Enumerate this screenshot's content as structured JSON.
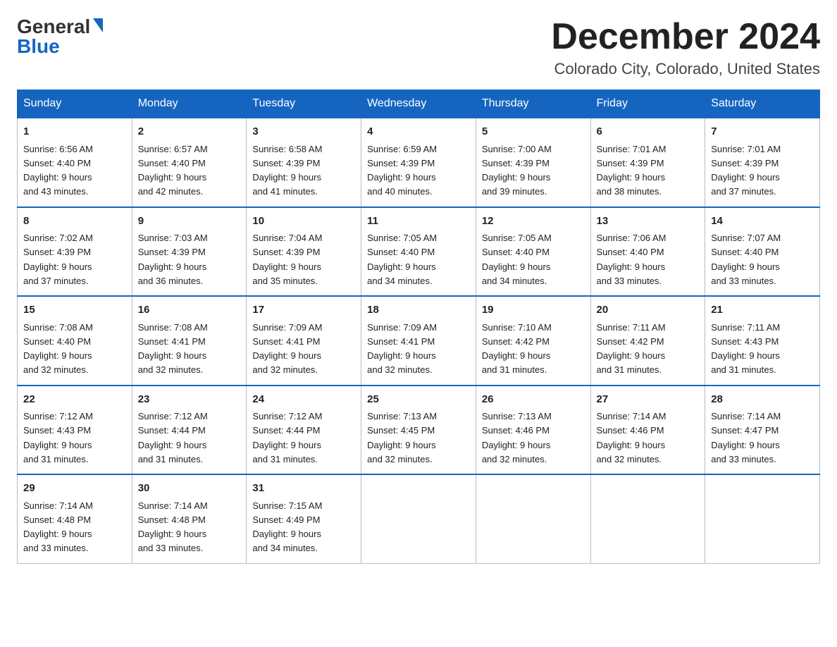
{
  "header": {
    "logo_general": "General",
    "logo_blue": "Blue",
    "month": "December 2024",
    "location": "Colorado City, Colorado, United States"
  },
  "days_of_week": [
    "Sunday",
    "Monday",
    "Tuesday",
    "Wednesday",
    "Thursday",
    "Friday",
    "Saturday"
  ],
  "weeks": [
    [
      {
        "day": "1",
        "sunrise": "6:56 AM",
        "sunset": "4:40 PM",
        "daylight": "9 hours and 43 minutes."
      },
      {
        "day": "2",
        "sunrise": "6:57 AM",
        "sunset": "4:40 PM",
        "daylight": "9 hours and 42 minutes."
      },
      {
        "day": "3",
        "sunrise": "6:58 AM",
        "sunset": "4:39 PM",
        "daylight": "9 hours and 41 minutes."
      },
      {
        "day": "4",
        "sunrise": "6:59 AM",
        "sunset": "4:39 PM",
        "daylight": "9 hours and 40 minutes."
      },
      {
        "day": "5",
        "sunrise": "7:00 AM",
        "sunset": "4:39 PM",
        "daylight": "9 hours and 39 minutes."
      },
      {
        "day": "6",
        "sunrise": "7:01 AM",
        "sunset": "4:39 PM",
        "daylight": "9 hours and 38 minutes."
      },
      {
        "day": "7",
        "sunrise": "7:01 AM",
        "sunset": "4:39 PM",
        "daylight": "9 hours and 37 minutes."
      }
    ],
    [
      {
        "day": "8",
        "sunrise": "7:02 AM",
        "sunset": "4:39 PM",
        "daylight": "9 hours and 37 minutes."
      },
      {
        "day": "9",
        "sunrise": "7:03 AM",
        "sunset": "4:39 PM",
        "daylight": "9 hours and 36 minutes."
      },
      {
        "day": "10",
        "sunrise": "7:04 AM",
        "sunset": "4:39 PM",
        "daylight": "9 hours and 35 minutes."
      },
      {
        "day": "11",
        "sunrise": "7:05 AM",
        "sunset": "4:40 PM",
        "daylight": "9 hours and 34 minutes."
      },
      {
        "day": "12",
        "sunrise": "7:05 AM",
        "sunset": "4:40 PM",
        "daylight": "9 hours and 34 minutes."
      },
      {
        "day": "13",
        "sunrise": "7:06 AM",
        "sunset": "4:40 PM",
        "daylight": "9 hours and 33 minutes."
      },
      {
        "day": "14",
        "sunrise": "7:07 AM",
        "sunset": "4:40 PM",
        "daylight": "9 hours and 33 minutes."
      }
    ],
    [
      {
        "day": "15",
        "sunrise": "7:08 AM",
        "sunset": "4:40 PM",
        "daylight": "9 hours and 32 minutes."
      },
      {
        "day": "16",
        "sunrise": "7:08 AM",
        "sunset": "4:41 PM",
        "daylight": "9 hours and 32 minutes."
      },
      {
        "day": "17",
        "sunrise": "7:09 AM",
        "sunset": "4:41 PM",
        "daylight": "9 hours and 32 minutes."
      },
      {
        "day": "18",
        "sunrise": "7:09 AM",
        "sunset": "4:41 PM",
        "daylight": "9 hours and 32 minutes."
      },
      {
        "day": "19",
        "sunrise": "7:10 AM",
        "sunset": "4:42 PM",
        "daylight": "9 hours and 31 minutes."
      },
      {
        "day": "20",
        "sunrise": "7:11 AM",
        "sunset": "4:42 PM",
        "daylight": "9 hours and 31 minutes."
      },
      {
        "day": "21",
        "sunrise": "7:11 AM",
        "sunset": "4:43 PM",
        "daylight": "9 hours and 31 minutes."
      }
    ],
    [
      {
        "day": "22",
        "sunrise": "7:12 AM",
        "sunset": "4:43 PM",
        "daylight": "9 hours and 31 minutes."
      },
      {
        "day": "23",
        "sunrise": "7:12 AM",
        "sunset": "4:44 PM",
        "daylight": "9 hours and 31 minutes."
      },
      {
        "day": "24",
        "sunrise": "7:12 AM",
        "sunset": "4:44 PM",
        "daylight": "9 hours and 31 minutes."
      },
      {
        "day": "25",
        "sunrise": "7:13 AM",
        "sunset": "4:45 PM",
        "daylight": "9 hours and 32 minutes."
      },
      {
        "day": "26",
        "sunrise": "7:13 AM",
        "sunset": "4:46 PM",
        "daylight": "9 hours and 32 minutes."
      },
      {
        "day": "27",
        "sunrise": "7:14 AM",
        "sunset": "4:46 PM",
        "daylight": "9 hours and 32 minutes."
      },
      {
        "day": "28",
        "sunrise": "7:14 AM",
        "sunset": "4:47 PM",
        "daylight": "9 hours and 33 minutes."
      }
    ],
    [
      {
        "day": "29",
        "sunrise": "7:14 AM",
        "sunset": "4:48 PM",
        "daylight": "9 hours and 33 minutes."
      },
      {
        "day": "30",
        "sunrise": "7:14 AM",
        "sunset": "4:48 PM",
        "daylight": "9 hours and 33 minutes."
      },
      {
        "day": "31",
        "sunrise": "7:15 AM",
        "sunset": "4:49 PM",
        "daylight": "9 hours and 34 minutes."
      },
      null,
      null,
      null,
      null
    ]
  ],
  "labels": {
    "sunrise": "Sunrise:",
    "sunset": "Sunset:",
    "daylight": "Daylight:"
  }
}
